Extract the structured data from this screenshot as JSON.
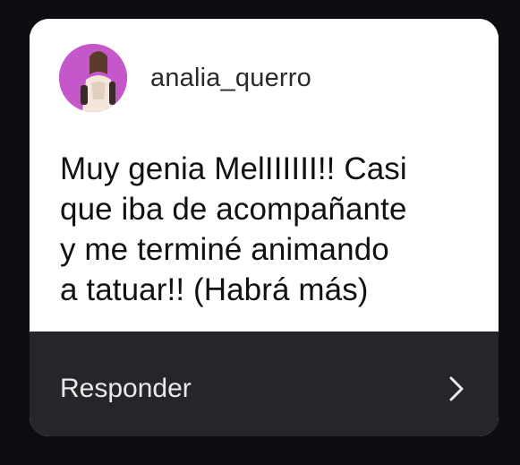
{
  "card": {
    "username": "analia_querro",
    "message": "Muy genia MelIIIIII!! Casi\nque iba de acompañante\ny me terminé animando\na tatuar!! (Habrá más)",
    "reply_label": "Responder"
  },
  "icons": {
    "avatar": "profile-photo",
    "chevron": "chevron-right-icon"
  },
  "colors": {
    "page_background": "#0b0d10",
    "card_background": "#ffffff",
    "reply_bar_background": "#24262a",
    "avatar_accent": "#c052c8"
  }
}
